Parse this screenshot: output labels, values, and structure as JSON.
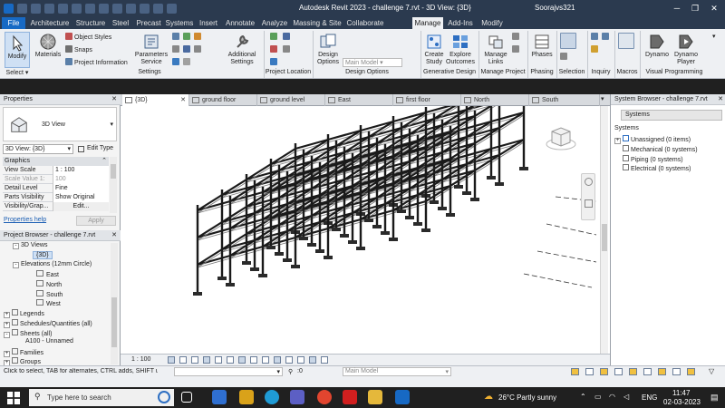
{
  "titlebar": {
    "title": "Autodesk Revit 2023 - challenge 7.rvt - 3D View: {3D}",
    "user": "Soorajvs321"
  },
  "ribbon_tabs": [
    "File",
    "Architecture",
    "Structure",
    "Steel",
    "Precast",
    "Systems",
    "Insert",
    "Annotate",
    "Analyze",
    "Massing & Site",
    "Collaborate",
    "Manage",
    "Add-Ins",
    "Modify"
  ],
  "ribbon": {
    "modify": "Modify",
    "select": "Select ▾",
    "materials": "Materials",
    "object_styles": "Object  Styles",
    "snaps": "Snaps",
    "project_information": "Project  Information",
    "parameters_service": "Parameters Service",
    "additional_settings": "Additional Settings",
    "settings_label": "Settings",
    "project_location_label": "Project Location",
    "design_options": "Design Options",
    "main_model": "Main Model",
    "design_options_label": "Design Options",
    "create_study": "Create Study",
    "explore_outcomes": "Explore Outcomes",
    "generative_design_label": "Generative Design",
    "manage_links": "Manage Links",
    "manage_project_label": "Manage Project",
    "phases": "Phases",
    "phasing_label": "Phasing",
    "selection_label": "Selection",
    "inquiry_label": "Inquiry",
    "macros_label": "Macros",
    "dynamo": "Dynamo",
    "dynamo_player": "Dynamo Player",
    "visual_programming_label": "Visual Programming"
  },
  "properties": {
    "title": "Properties",
    "type_name": "3D View",
    "view_selector": "3D View: {3D}",
    "edit_type": "Edit Type",
    "section": "Graphics",
    "rows": [
      {
        "k": "View Scale",
        "v": "1 : 100"
      },
      {
        "k": "Scale Value   1:",
        "v": "100"
      },
      {
        "k": "Detail Level",
        "v": "Fine"
      },
      {
        "k": "Parts Visibility",
        "v": "Show Original"
      },
      {
        "k": "Visibility/Grap...",
        "v": "Edit..."
      }
    ],
    "help": "Properties help",
    "apply": "Apply"
  },
  "project_browser": {
    "title": "Project Browser - challenge 7.rvt",
    "items": [
      "3D Views",
      "{3D}",
      "Elevations (12mm Circle)",
      "East",
      "North",
      "South",
      "West",
      "Legends",
      "Schedules/Quantities (all)",
      "Sheets (all)",
      "A100 - Unnamed",
      "Families",
      "Groups"
    ]
  },
  "view_tabs": [
    "{3D}",
    "ground floor",
    "ground level",
    "East",
    "first floor",
    "North",
    "South"
  ],
  "viewbar": {
    "scale": "1 : 100"
  },
  "system_browser": {
    "title": "System Browser - challenge 7.rvt",
    "dropdown": "Systems",
    "header": "Systems",
    "items": [
      "Unassigned (0 items)",
      "Mechanical (0 systems)",
      "Piping (0 systems)",
      "Electrical (0 systems)"
    ]
  },
  "status": {
    "hint": "Click to select, TAB for alternates, CTRL adds, SHIFT unse",
    "count": ":0",
    "model": "Main Model"
  },
  "taskbar": {
    "search": "Type here to search",
    "weather": "26°C  Partly sunny",
    "lang": "ENG",
    "time": "11:47",
    "date": "02-03-2023"
  },
  "colors": {
    "accent": "#1769c4",
    "titlebar": "#2b3a4f",
    "ribbon": "#eef0f3"
  }
}
